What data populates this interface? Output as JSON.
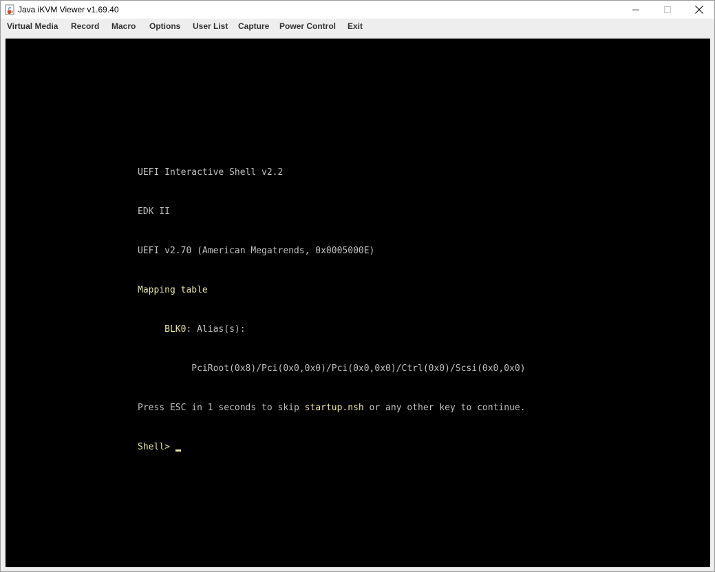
{
  "window": {
    "title": "Java iKVM Viewer v1.69.40"
  },
  "menu": [
    {
      "label": "Virtual Media"
    },
    {
      "label": "Record"
    },
    {
      "label": "Macro"
    },
    {
      "label": "Options"
    },
    {
      "label": "User List"
    },
    {
      "label": "Capture"
    },
    {
      "label": "Power Control"
    },
    {
      "label": "Exit"
    }
  ],
  "console": {
    "line1": "UEFI Interactive Shell v2.2",
    "line2": "EDK II",
    "line3": "UEFI v2.70 (American Megatrends, 0x0005000E)",
    "line4": "Mapping table",
    "line5_indent": "     ",
    "line5_device": "BLK0",
    "line5_rest": ": Alias(s):",
    "line6": "          PciRoot(0x8)/Pci(0x0,0x0)/Pci(0x0,0x0)/Ctrl(0x0)/Scsi(0x0,0x0)",
    "line7_pre": "Press ESC in 1 seconds to skip ",
    "line7_file": "startup.nsh",
    "line7_post": " or any other key to continue.",
    "prompt": "Shell> "
  },
  "colors": {
    "console_text": "#c0c0c0",
    "console_highlight": "#e6e6a0",
    "screen_background": "#000000"
  },
  "icons": {
    "app": "java-cup-icon",
    "minimize": "minimize-icon",
    "maximize": "maximize-icon",
    "close": "close-icon"
  }
}
